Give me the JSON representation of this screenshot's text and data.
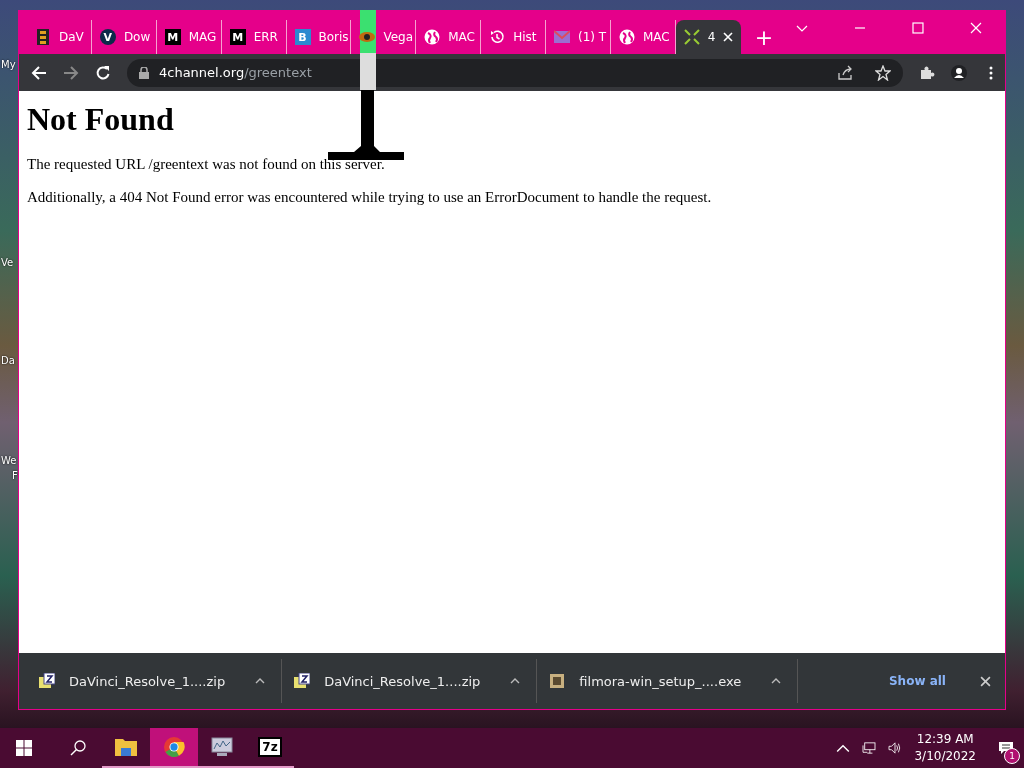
{
  "desktop": {
    "icon_labels": [
      "My",
      "Ve",
      "Da",
      "We",
      "F"
    ]
  },
  "browser": {
    "tabs": [
      {
        "kind": "film",
        "title": "DaV",
        "selected": false
      },
      {
        "kind": "letter-circle",
        "letter": "V",
        "title": "Dow",
        "selected": false
      },
      {
        "kind": "letter-square",
        "letter": "M",
        "title": "MAG",
        "selected": false
      },
      {
        "kind": "letter-square",
        "letter": "M",
        "title": "ERR",
        "selected": false
      },
      {
        "kind": "letter-blue",
        "letter": "B",
        "title": "Boris",
        "selected": false
      },
      {
        "kind": "eye",
        "title": "Vega",
        "selected": false
      },
      {
        "kind": "globe",
        "title": "MAC",
        "selected": false
      },
      {
        "kind": "history",
        "title": "Hist",
        "selected": false
      },
      {
        "kind": "mail",
        "title": "(1) T",
        "selected": false
      },
      {
        "kind": "globe",
        "title": "MAC",
        "selected": false
      },
      {
        "kind": "grid",
        "title": "4",
        "selected": true
      }
    ],
    "new_tab": "+",
    "address": {
      "host": "4channel.org",
      "path": "/greentext"
    }
  },
  "page": {
    "heading": "Not Found",
    "paragraphs": [
      "The requested URL /greentext was not found on this server.",
      "Additionally, a 404 Not Found error was encountered while trying to use an ErrorDocument to handle the request."
    ]
  },
  "downloads": {
    "items": [
      {
        "kind": "zip",
        "name": "DaVinci_Resolve_1....zip"
      },
      {
        "kind": "zip",
        "name": "DaVinci_Resolve_1....zip"
      },
      {
        "kind": "exe",
        "name": "filmora-win_setup_....exe"
      }
    ],
    "show_all": "Show all"
  },
  "taskbar": {
    "apps": [
      {
        "kind": "folder",
        "selected": false
      },
      {
        "kind": "chrome",
        "selected": true
      },
      {
        "kind": "monitor",
        "selected": false
      },
      {
        "kind": "sevenzip",
        "label": "7z",
        "selected": false
      }
    ],
    "time": "12:39 AM",
    "date": "3/10/2022",
    "notifications": "1"
  }
}
